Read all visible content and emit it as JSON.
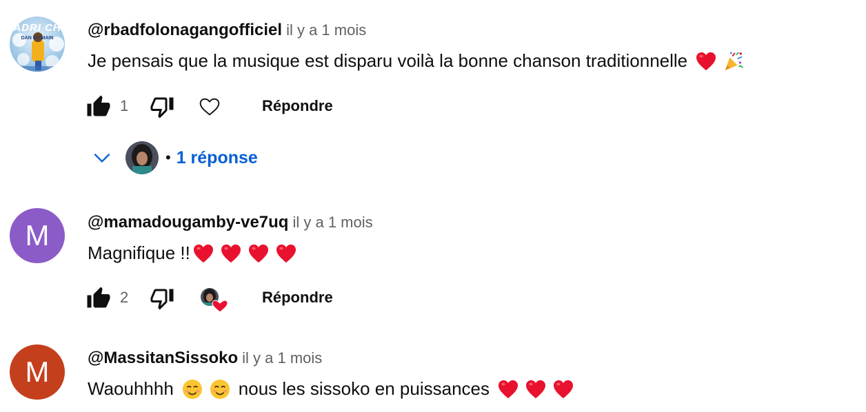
{
  "comments": [
    {
      "author": "@rbadfolonagangofficiel",
      "time": "il y a 1 mois",
      "text": "Je pensais que la musique est disparu voilà la bonne chanson traditionnelle",
      "emojis": [
        "red-heart",
        "party-popper"
      ],
      "avatar_text_line1": "ADRI CH",
      "avatar_text_line2": "DAN KA MAIN",
      "likes": "1",
      "reply_label": "Répondre",
      "replies_label": "1 réponse"
    },
    {
      "author": "@mamadougamby-ve7uq",
      "time": "il y a 1 mois",
      "text": "Magnifique !!",
      "emojis": [
        "red-heart",
        "red-heart",
        "red-heart",
        "red-heart"
      ],
      "avatar_letter": "M",
      "avatar_color": "#8b5cc8",
      "likes": "2",
      "reply_label": "Répondre",
      "creator_heart": true
    },
    {
      "author": "@MassitanSissoko",
      "time": "il y a 1 mois",
      "text_before": "Waouhhhh",
      "text_after": "nous les sissoko en puissances",
      "emojis_before": [
        "smiling-face",
        "smiling-face"
      ],
      "emojis_after": [
        "red-heart",
        "red-heart",
        "red-heart"
      ],
      "avatar_letter": "M",
      "avatar_color": "#c43f1c"
    }
  ],
  "colors": {
    "link_blue": "#065fd4",
    "muted": "#606060",
    "heart_red": "#e8122e"
  }
}
